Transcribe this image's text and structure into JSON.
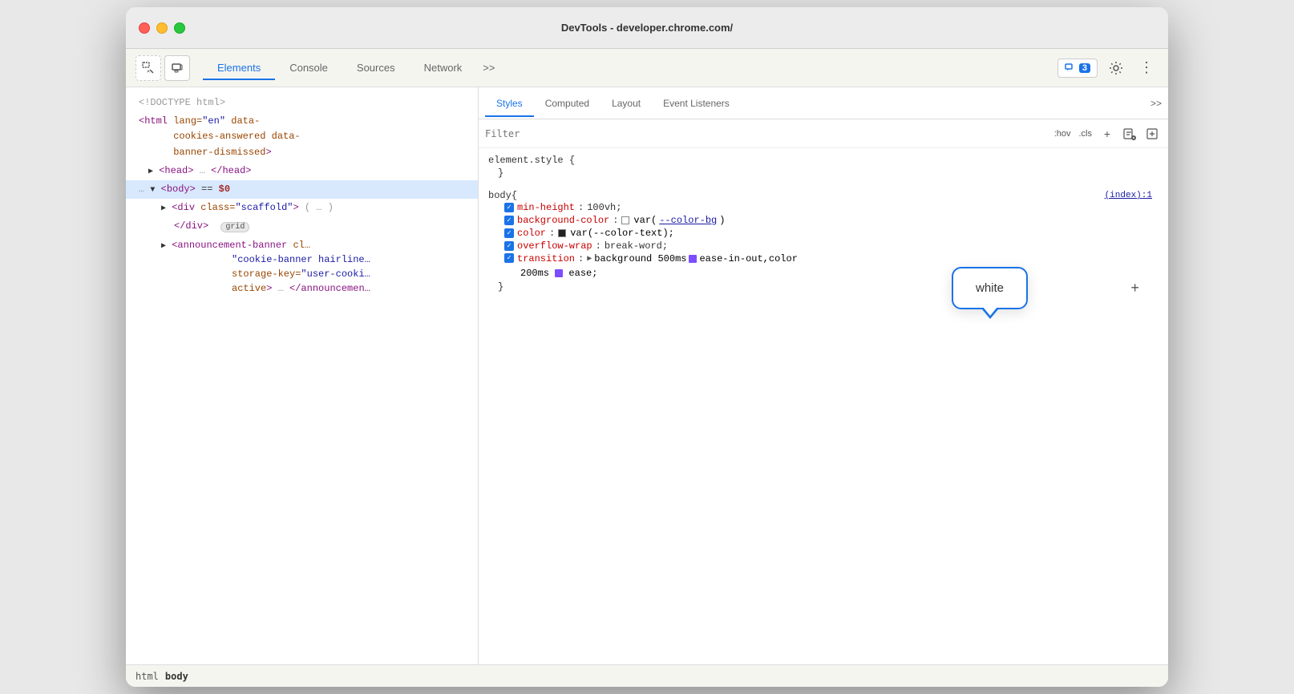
{
  "window": {
    "title": "DevTools - developer.chrome.com/"
  },
  "toolbar": {
    "tabs": [
      "Elements",
      "Console",
      "Sources",
      "Network"
    ],
    "more": ">>",
    "badge_label": "3",
    "active_tab": "Elements"
  },
  "styles_tabs": {
    "tabs": [
      "Styles",
      "Computed",
      "Layout",
      "Event Listeners"
    ],
    "more": ">>",
    "active": "Styles"
  },
  "filter": {
    "placeholder": "Filter",
    "hov_label": ":hov",
    "cls_label": ".cls"
  },
  "dom": {
    "lines": [
      {
        "type": "comment",
        "text": "<!DOCTYPE html>",
        "indent": 0
      },
      {
        "type": "open",
        "text": "<html lang=\"en\" data-cookies-answered data-banner-dismissed>",
        "indent": 0
      },
      {
        "type": "collapsed",
        "text": "<head>…</head>",
        "indent": 1
      },
      {
        "type": "selected",
        "text": "… ▼ <body> == $0",
        "indent": 0
      },
      {
        "type": "child",
        "text": "▶ <div class=\"scaffold\"> (…)",
        "indent": 1
      },
      {
        "type": "child",
        "text": "</div>  grid",
        "indent": 2
      },
      {
        "type": "child",
        "text": "▶ <announcement-banner cl… \"cookie-banner hairline… storage-key=\"user-cooki… active> … </announcement…",
        "indent": 1
      }
    ]
  },
  "breadcrumb": {
    "items": [
      "html",
      "body"
    ]
  },
  "css_rules": [
    {
      "selector": "element.style {",
      "props": [],
      "close": "}"
    },
    {
      "selector": "body {",
      "source": "(index):1",
      "props": [
        {
          "prop": "min-height",
          "val": "100vh;",
          "checked": true
        },
        {
          "prop": "background-color",
          "val_type": "color_var",
          "val": "var(--color-bg)",
          "color": "white",
          "checked": true,
          "tooltip": true
        },
        {
          "prop": "color",
          "val_type": "color_swatch",
          "swatch": "#222",
          "val": "var(--color-text);",
          "checked": true
        },
        {
          "prop": "overflow-wrap",
          "val": "break-word;",
          "checked": true
        },
        {
          "prop": "transition",
          "val": "▶ background 500ms",
          "val2": "ease-in-out,color 200ms",
          "val3": "ease;",
          "checked": true,
          "has_checkbox2": true
        }
      ],
      "close": "}"
    }
  ],
  "tooltip": {
    "text": "white"
  }
}
